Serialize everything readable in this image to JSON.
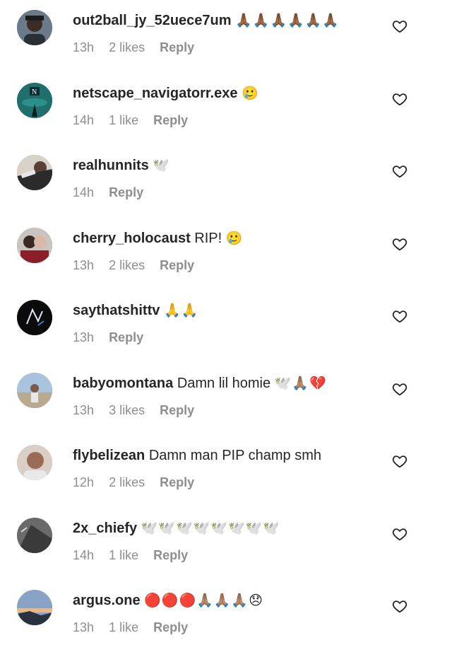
{
  "comments": [
    {
      "username": "out2ball_jy_52uece7um",
      "text": "",
      "emoji": "🙏🏾🙏🏾🙏🏾🙏🏾🙏🏾🙏🏾",
      "time": "13h",
      "likes": "2 likes",
      "reply": "Reply",
      "avatar_color": "#6b7a8a"
    },
    {
      "username": "netscape_navigatorr.exe",
      "text": "",
      "emoji": "🥲",
      "time": "14h",
      "likes": "1 like",
      "reply": "Reply",
      "avatar_color": "#1f6f6c"
    },
    {
      "username": "realhunnits",
      "text": "",
      "emoji": "🕊️",
      "time": "14h",
      "likes": "",
      "reply": "Reply",
      "avatar_color": "#3a3a3a"
    },
    {
      "username": "cherry_holocaust",
      "text": "RIP!",
      "emoji": "🥲",
      "time": "13h",
      "likes": "2 likes",
      "reply": "Reply",
      "avatar_color": "#8a3b3b"
    },
    {
      "username": "saythatshittv",
      "text": "",
      "emoji": "🙏🙏",
      "time": "13h",
      "likes": "",
      "reply": "Reply",
      "avatar_color": "#111111"
    },
    {
      "username": "babyomontana",
      "text": "Damn lil homie",
      "emoji": "🕊️🙏🏽💔",
      "time": "13h",
      "likes": "3 likes",
      "reply": "Reply",
      "avatar_color": "#8fa8c8"
    },
    {
      "username": "flybelizean",
      "text": "Damn man PIP champ smh",
      "emoji": "",
      "time": "12h",
      "likes": "2 likes",
      "reply": "Reply",
      "avatar_color": "#b08a78"
    },
    {
      "username": "2x_chiefy",
      "text": "",
      "emoji": "🕊️🕊️🕊️🕊️🕊️🕊️🕊️🕊️",
      "time": "14h",
      "likes": "1 like",
      "reply": "Reply",
      "avatar_color": "#4a4a4a"
    },
    {
      "username": "argus.one",
      "text": "",
      "emoji": "🔴🔴🔴🙏🏽🙏🏽🙏🏽😞",
      "time": "13h",
      "likes": "1 like",
      "reply": "Reply",
      "avatar_color": "#5a6f8a"
    }
  ]
}
